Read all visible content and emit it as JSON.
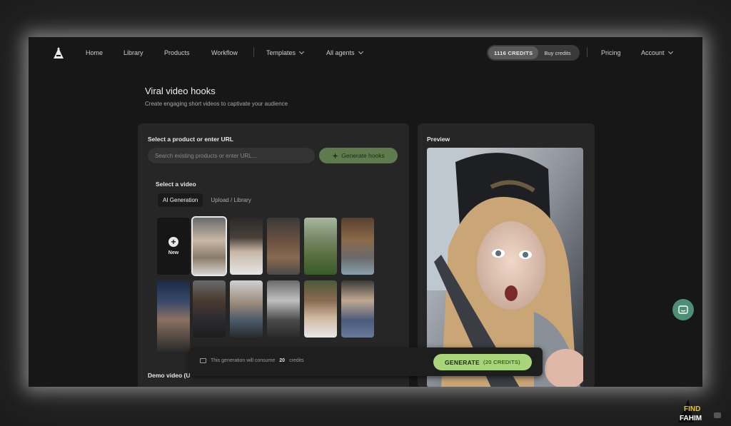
{
  "nav": {
    "links": [
      "Home",
      "Library",
      "Products",
      "Workflow"
    ],
    "dropdowns": [
      "Templates",
      "All agents"
    ],
    "credits": "1116 CREDITS",
    "buy_credits": "Buy credits",
    "pricing": "Pricing",
    "account": "Account"
  },
  "page": {
    "title": "Viral video hooks",
    "subtitle": "Create engaging short videos to captivate your audience"
  },
  "form": {
    "product_label": "Select a product or enter URL",
    "search_placeholder": "Search existing products or enter URL...",
    "generate_hooks": "Generate hooks",
    "video_label": "Select a video",
    "tabs": [
      "AI Generation",
      "Upload / Library"
    ],
    "new_label": "New",
    "demo_label": "Demo video (U"
  },
  "preview": {
    "label": "Preview"
  },
  "generate_bar": {
    "info_prefix": "This generation will consume",
    "info_amount": "20",
    "info_suffix": "credits",
    "button": "GENERATE",
    "button_credits": "(20 CREDITS)"
  },
  "watermark": {
    "line1": "FIND",
    "line2": "FAHIM"
  },
  "colors": {
    "accent_green": "#a8d47a",
    "chat": "#4d8f76"
  }
}
